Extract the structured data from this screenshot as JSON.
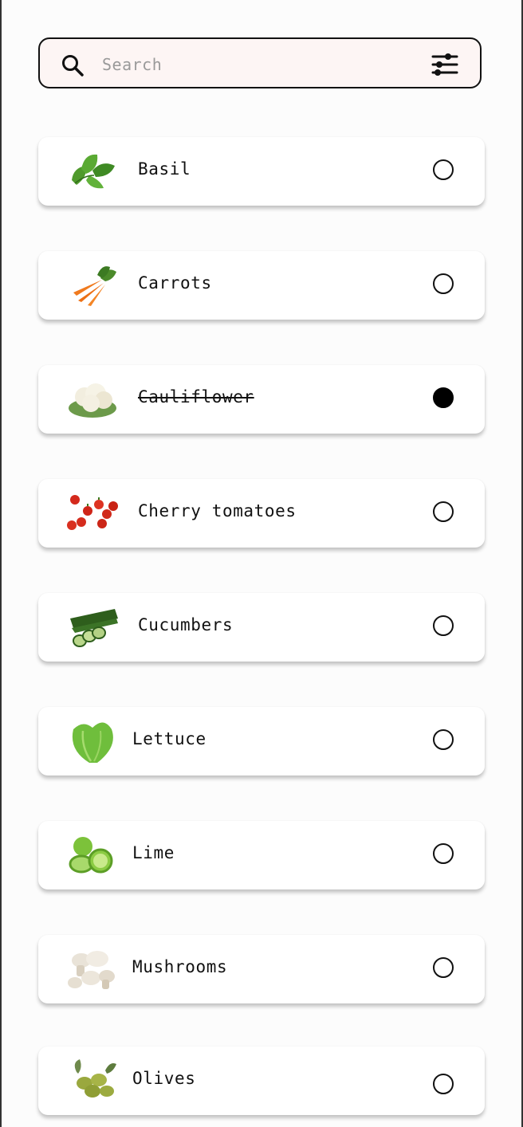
{
  "search": {
    "placeholder": "Search",
    "value": ""
  },
  "items": [
    {
      "label": "Basil",
      "checked": false,
      "icon": "basil-icon"
    },
    {
      "label": "Carrots",
      "checked": false,
      "icon": "carrots-icon"
    },
    {
      "label": "Cauliflower",
      "checked": true,
      "icon": "cauliflower-icon"
    },
    {
      "label": "Cherry tomatoes",
      "checked": false,
      "icon": "cherry-tomatoes-icon"
    },
    {
      "label": "Cucumbers",
      "checked": false,
      "icon": "cucumbers-icon"
    },
    {
      "label": "Lettuce",
      "checked": false,
      "icon": "lettuce-icon"
    },
    {
      "label": "Lime",
      "checked": false,
      "icon": "lime-icon"
    },
    {
      "label": "Mushrooms",
      "checked": false,
      "icon": "mushrooms-icon"
    },
    {
      "label": "Olives",
      "checked": false,
      "icon": "olives-icon"
    }
  ]
}
